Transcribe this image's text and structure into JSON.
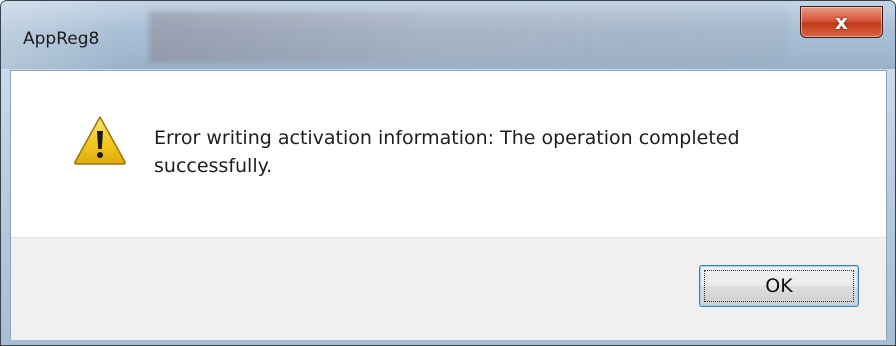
{
  "window": {
    "title": "AppReg8",
    "close_glyph": "x"
  },
  "dialog": {
    "icon": "warning-icon",
    "message": "Error writing activation information: The operation completed successfully.",
    "ok_label": "OK"
  },
  "colors": {
    "close_button": "#c9452a",
    "warning_fill": "#f2c81f",
    "focus_border": "#3c7fb1"
  }
}
